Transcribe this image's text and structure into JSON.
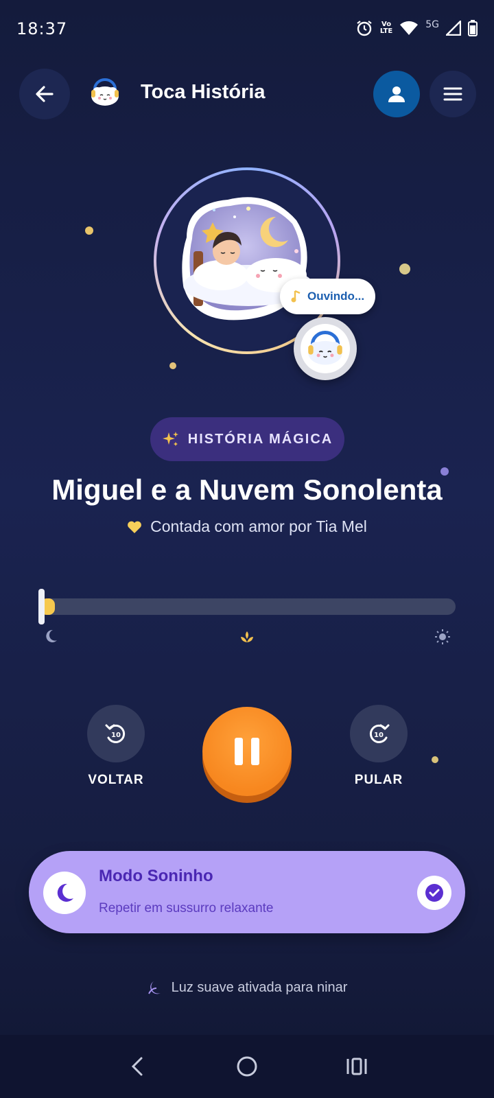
{
  "status_bar": {
    "time": "18:37",
    "network_label": "5G",
    "volte_top": "Vo",
    "volte_bottom": "LTE",
    "icons": [
      "alarm-icon",
      "volte-icon",
      "wifi-icon",
      "signal-icon",
      "battery-icon"
    ]
  },
  "header": {
    "title": "Toca História",
    "icons": [
      "back-arrow-icon",
      "cloud-mascot-logo",
      "profile-icon",
      "menu-icon"
    ]
  },
  "cover": {
    "listening_label": "Ouvindo...",
    "listening_icon": "music-note-icon"
  },
  "story": {
    "badge": "HISTÓRIA MÁGICA",
    "badge_icon": "sparkles-icon",
    "title": "Miguel e a Nuvem Sonolenta",
    "author": "Contada com amor por Tia Mel",
    "author_icon": "heart-icon"
  },
  "progress": {
    "value": 0.02,
    "markers": [
      "moon-icon",
      "lotus-icon",
      "sun-icon"
    ]
  },
  "controls": {
    "back_label": "VOLTAR",
    "forward_label": "PULAR",
    "skip_seconds": "10",
    "state": "playing"
  },
  "sleep_mode": {
    "title": "Modo Soninho",
    "subtitle": "Repetir em sussurro relaxante",
    "enabled": true
  },
  "hint": {
    "text": "Luz suave ativada para ninar",
    "icon": "moon-leaf-icon"
  },
  "colors": {
    "background": "#1a2350",
    "accent_orange": "#f7871f",
    "sleep_card": "#b5a1f7",
    "badge_purple": "#3b2f7e",
    "progress_yellow": "#f2c14e"
  }
}
